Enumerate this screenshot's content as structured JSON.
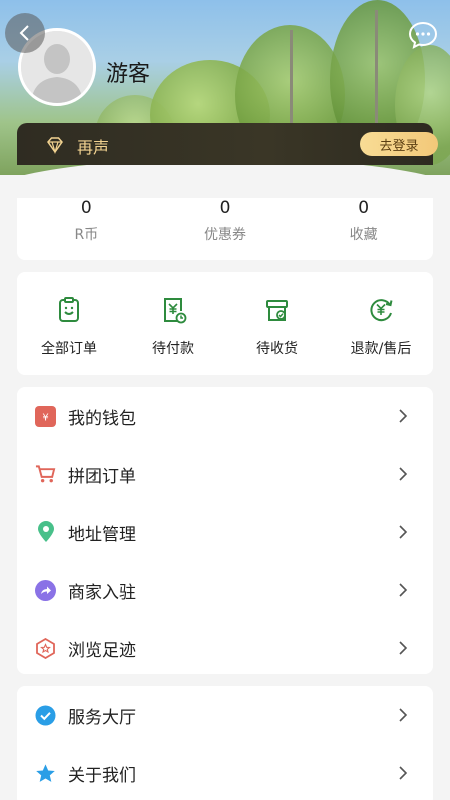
{
  "profile": {
    "username": "游客",
    "vip_label": "再声",
    "login_button": "去登录"
  },
  "stats": [
    {
      "value": "0",
      "label": "R币"
    },
    {
      "value": "0",
      "label": "优惠券"
    },
    {
      "value": "0",
      "label": "收藏"
    }
  ],
  "orders": [
    {
      "label": "全部订单",
      "icon": "clipboard-icon"
    },
    {
      "label": "待付款",
      "icon": "bill-yen-icon"
    },
    {
      "label": "待收货",
      "icon": "package-icon"
    },
    {
      "label": "退款/售后",
      "icon": "refund-yen-icon"
    }
  ],
  "menu": [
    {
      "label": "我的钱包",
      "icon": "wallet-icon"
    },
    {
      "label": "拼团订单",
      "icon": "cart-icon"
    },
    {
      "label": "地址管理",
      "icon": "location-pin-icon"
    },
    {
      "label": "商家入驻",
      "icon": "share-arrow-icon"
    },
    {
      "label": "浏览足迹",
      "icon": "footprint-icon"
    },
    {
      "label": "服务大厅",
      "icon": "check-circle-icon"
    },
    {
      "label": "关于我们",
      "icon": "star-icon"
    }
  ],
  "colors": {
    "accent_green": "#2e8b3e",
    "vip_gold": "#f2d391",
    "vip_bar": "#34301f"
  }
}
